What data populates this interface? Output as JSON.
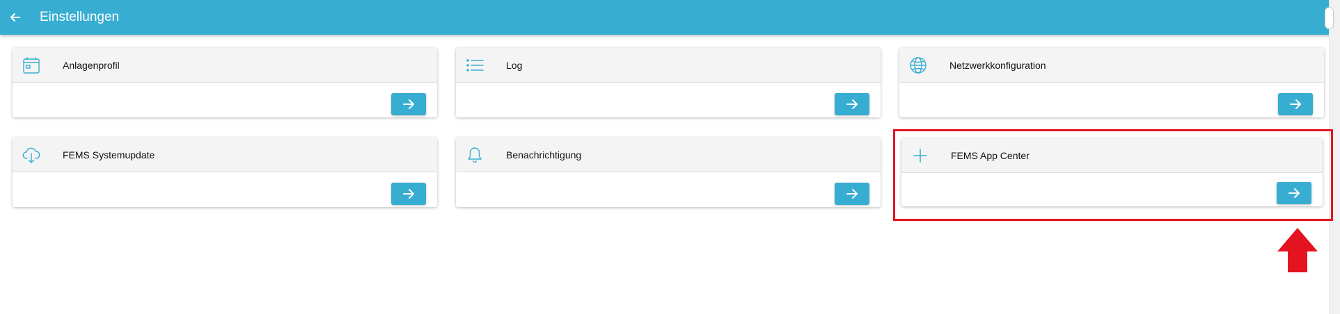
{
  "header": {
    "title": "Einstellungen",
    "back_icon": "arrow-left-icon"
  },
  "cards": [
    {
      "label": "Anlagenprofil",
      "icon": "calendar-icon"
    },
    {
      "label": "Log",
      "icon": "list-icon"
    },
    {
      "label": "Netzwerkkonfiguration",
      "icon": "globe-icon"
    },
    {
      "label": "FEMS Systemupdate",
      "icon": "cloud-download-icon"
    },
    {
      "label": "Benachrichtigung",
      "icon": "bell-icon"
    },
    {
      "label": "FEMS App Center",
      "icon": "plus-icon"
    }
  ],
  "colors": {
    "accent": "#37add2",
    "card_header": "#f4f4f4",
    "annotation": "#e3141f"
  }
}
